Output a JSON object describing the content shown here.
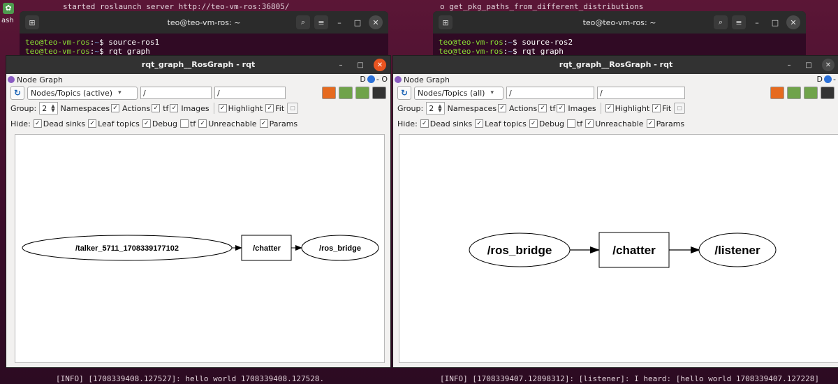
{
  "desktop": {
    "dock_label": "ash",
    "left_background_line": "started roslaunch server http://teo-vm-ros:36805/",
    "right_background_line": "o get_pkg_paths_from_different_distributions",
    "left_log_line": "[INFO] [1708339408.127527]: hello world 1708339408.127528.",
    "right_log_line": "[INFO] [1708339407.12898312]: [listener]: I heard: [hello world 1708339407.127228]"
  },
  "terminals": [
    {
      "title": "teo@teo-vm-ros: ~",
      "lines": [
        {
          "user": "teo@teo-vm-ros",
          "sep": ":",
          "path": "~",
          "cmd": "$ source-ros1"
        },
        {
          "user": "teo@teo-vm-ros",
          "sep": ":",
          "path": "~",
          "cmd": "$ rqt_graph"
        }
      ]
    },
    {
      "title": "teo@teo-vm-ros: ~",
      "lines": [
        {
          "user": "teo@teo-vm-ros",
          "sep": ":",
          "path": "~",
          "cmd": "$ source-ros2"
        },
        {
          "user": "teo@teo-vm-ros",
          "sep": ":",
          "path": "~",
          "cmd": "$ rqt_graph"
        }
      ]
    }
  ],
  "rqt_windows": [
    {
      "title": "rqt_graph__RosGraph - rqt",
      "plugin_title": "Node Graph",
      "plugin_right_label": "D",
      "plugin_right_extra": "- O",
      "view_mode": "Nodes/Topics (active)",
      "filter_ns": "/",
      "filter_topic": "/",
      "group_label": "Group:",
      "group_value": "2",
      "options_group": [
        "Namespaces",
        "Actions",
        "tf",
        "Images"
      ],
      "options_view": [
        "Highlight",
        "Fit"
      ],
      "hide_label": "Hide:",
      "hide_options": [
        {
          "label": "Dead sinks",
          "checked": true
        },
        {
          "label": "Leaf topics",
          "checked": true
        },
        {
          "label": "Debug",
          "checked": true
        },
        {
          "label": "tf",
          "checked": false
        },
        {
          "label": "Unreachable",
          "checked": true
        },
        {
          "label": "Params",
          "checked": true
        }
      ],
      "graph": {
        "nodes": [
          "/talker_5711_1708339177102",
          "/ros_bridge"
        ],
        "topic": "/chatter"
      }
    },
    {
      "title": "rqt_graph__RosGraph - rqt",
      "plugin_title": "Node Graph",
      "plugin_right_label": "D",
      "plugin_right_extra": "-",
      "view_mode": "Nodes/Topics (all)",
      "filter_ns": "/",
      "filter_topic": "/",
      "group_label": "Group:",
      "group_value": "2",
      "options_group": [
        "Namespaces",
        "Actions",
        "tf",
        "Images"
      ],
      "options_view": [
        "Highlight",
        "Fit"
      ],
      "hide_label": "Hide:",
      "hide_options": [
        {
          "label": "Dead sinks",
          "checked": true
        },
        {
          "label": "Leaf topics",
          "checked": true
        },
        {
          "label": "Debug",
          "checked": true
        },
        {
          "label": "tf",
          "checked": false
        },
        {
          "label": "Unreachable",
          "checked": true
        },
        {
          "label": "Params",
          "checked": true
        }
      ],
      "graph": {
        "nodes": [
          "/ros_bridge",
          "/listener"
        ],
        "topic": "/chatter"
      }
    }
  ],
  "colors": {
    "close_accent": "#e95420",
    "terminal_bg": "#300a24",
    "prompt_green": "#8ae234",
    "prompt_blue": "#729fcf"
  }
}
